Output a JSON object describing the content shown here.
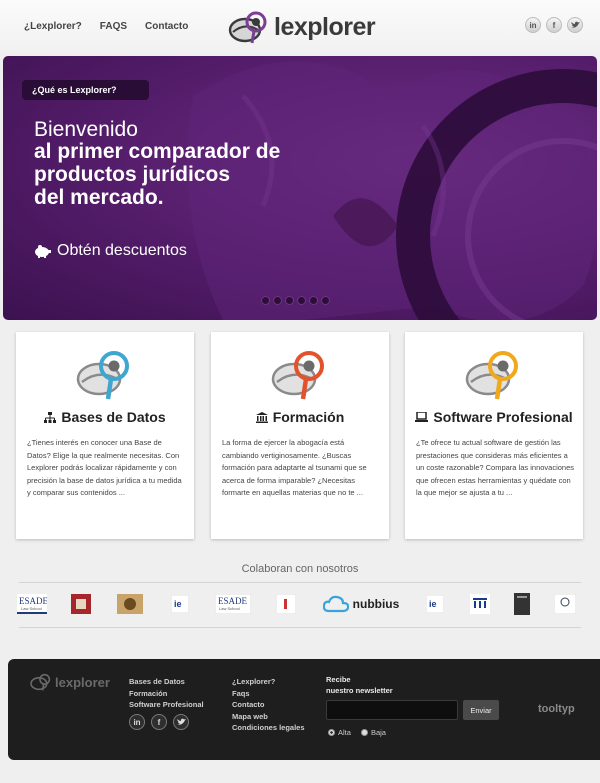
{
  "header": {
    "nav": [
      "¿Lexplorer?",
      "FAQS",
      "Contacto"
    ],
    "logo_text": "lexplorer",
    "social": [
      "in",
      "f",
      "t"
    ]
  },
  "hero": {
    "pill_label": "¿Qué es Lexplorer?",
    "line1": "Bienvenido",
    "line2": "al primer comparador de",
    "line3": "productos jurídicos",
    "line4": "del mercado.",
    "cta_label": "Obtén descuentos",
    "slides": 6
  },
  "cards": [
    {
      "title": "Bases de Datos",
      "accent": "#3ea6cf",
      "body": "¿Tienes interés en conocer una Base de Datos? Elige la que realmente necesitas. Con Lexplorer podrás localizar rápidamente y con precisión la base de datos jurídica a tu medida y comparar sus contenidos ..."
    },
    {
      "title": "Formación",
      "accent": "#e2522c",
      "body": "La forma de ejercer la abogacía está cambiando vertiginosamente. ¿Buscas formación para adaptarte al tsunami que se acerca de forma imparable? ¿Necesitas formarte en aquellas materias que no te ..."
    },
    {
      "title": "Software Profesional",
      "accent": "#f0a81c",
      "body": "¿Te ofrece tu actual software de gestión las prestaciones que consideras más eficientes a un coste razonable? Compara las innovaciones que ofrecen estas herramientas y quédate con la que mejor se ajusta a tu ..."
    }
  ],
  "collab": {
    "title": "Colaboran con nosotros",
    "partners": [
      "ESADE Law School",
      "logo",
      "logo",
      "ie",
      "ESADE Law School",
      "logo",
      "nubbius",
      "ie",
      "logo",
      "logo",
      "logo"
    ]
  },
  "footer": {
    "logo_text": "lexplorer",
    "col1": [
      "Bases de Datos",
      "Formación",
      "Software Profesional"
    ],
    "col2": [
      "¿Lexplorer?",
      "Faqs",
      "Contacto",
      "Mapa web",
      "Condiciones legales"
    ],
    "newsletter_title_1": "Recibe",
    "newsletter_title_2": "nuestro newsletter",
    "send_label": "Enviar",
    "radio_alta": "Alta",
    "radio_baja": "Baja",
    "brand": "tooltyp"
  }
}
